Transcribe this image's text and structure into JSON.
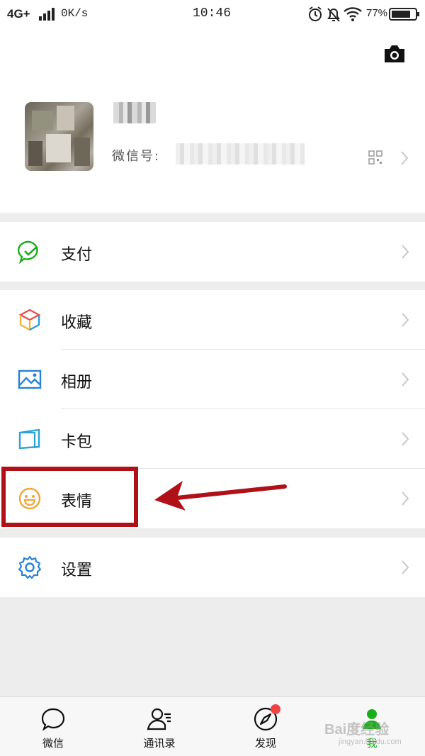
{
  "status_bar": {
    "network": "4G+",
    "speed": "0K/s",
    "time": "10:46",
    "battery_percent": "77%",
    "icons": [
      "alarm-icon",
      "bell-off-icon",
      "wifi-icon"
    ]
  },
  "profile": {
    "wechat_id_label": "微信号:",
    "icons": [
      "camera-icon",
      "qr-code-icon"
    ]
  },
  "menu": {
    "pay": {
      "label": "支付",
      "icon": "pay-icon",
      "color": "#1aad19"
    },
    "favorites": {
      "label": "收藏",
      "icon": "cube-icon"
    },
    "album": {
      "label": "相册",
      "icon": "image-icon",
      "color": "#2782d7"
    },
    "cards": {
      "label": "卡包",
      "icon": "card-icon",
      "color": "#2ba3d8"
    },
    "stickers": {
      "label": "表情",
      "icon": "smiley-icon",
      "color": "#f0a63a"
    },
    "settings": {
      "label": "设置",
      "icon": "gear-icon",
      "color": "#2782d7"
    }
  },
  "annotation": {
    "color": "#b01119"
  },
  "tabbar": {
    "tabs": [
      {
        "label": "微信",
        "icon": "chat-icon"
      },
      {
        "label": "通讯录",
        "icon": "contacts-icon"
      },
      {
        "label": "发现",
        "icon": "compass-icon",
        "badge": true
      },
      {
        "label": "我",
        "icon": "me-icon",
        "active": true
      }
    ],
    "active_color": "#1aad19"
  },
  "watermark": {
    "text": "Bai度经验",
    "sub": "jingyan.baidu.com"
  }
}
